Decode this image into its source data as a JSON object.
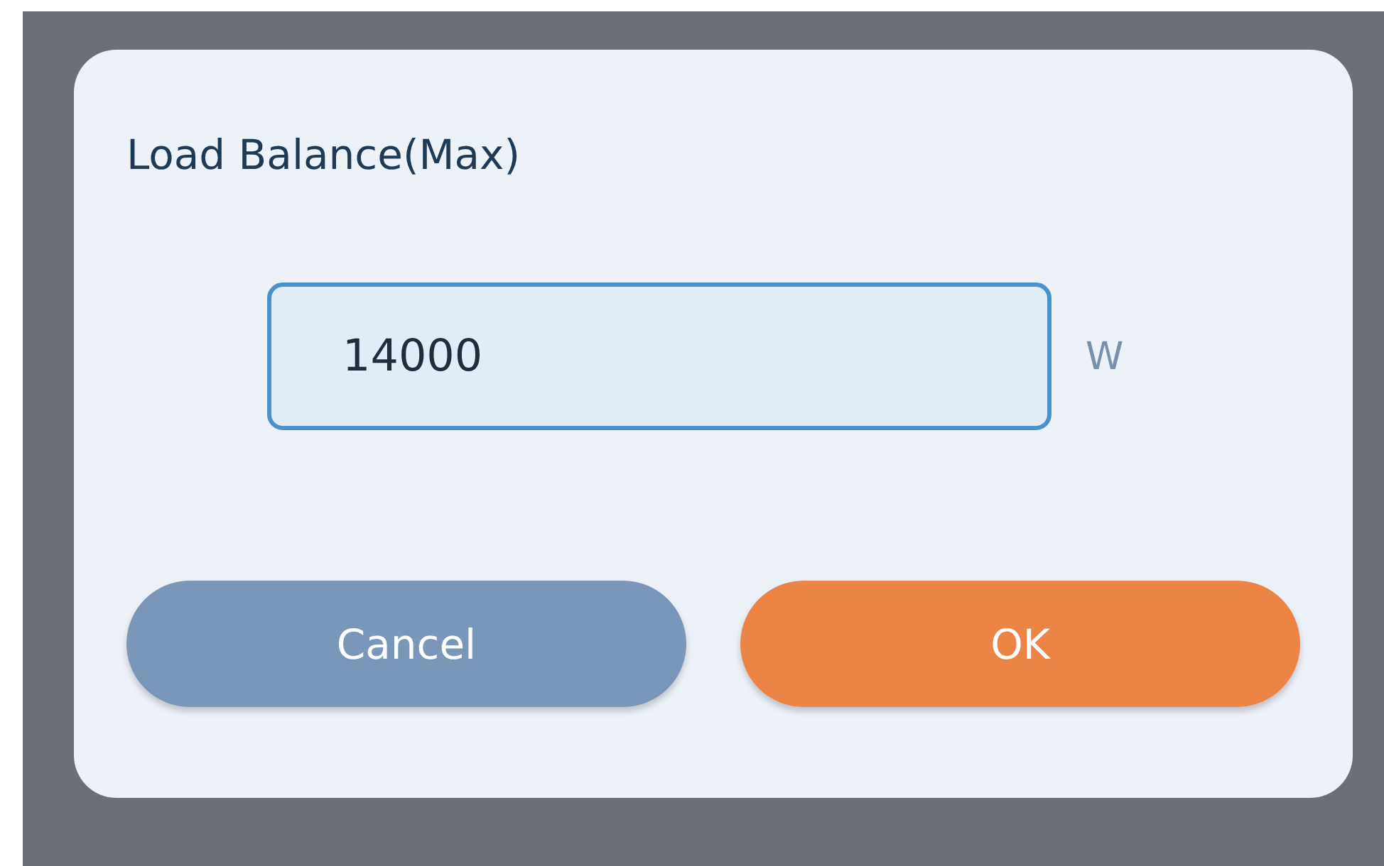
{
  "dialog": {
    "title": "Load Balance(Max)",
    "field": {
      "value": "14000",
      "unit": "W"
    },
    "buttons": [
      {
        "label": "Cancel",
        "kind": "secondary"
      },
      {
        "label": "OK",
        "kind": "primary"
      }
    ]
  }
}
